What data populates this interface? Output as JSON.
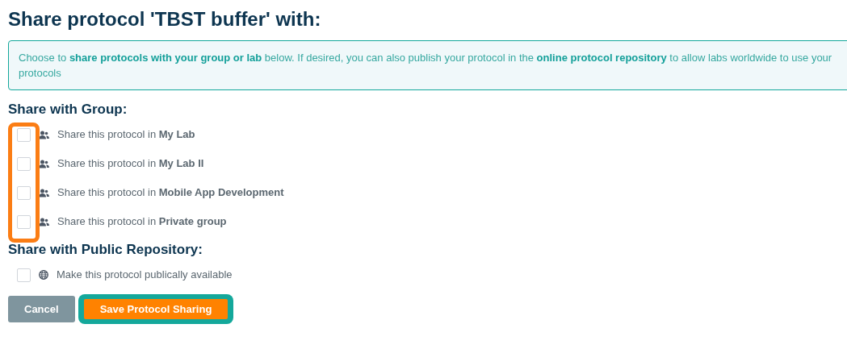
{
  "title": "Share protocol 'TBST buffer' with:",
  "info": "Choose to **share protocols with your group or lab** below. If desired, you can also publish your protocol in the **online protocol repository** to allow labs worldwide to use your protocols",
  "group_section": {
    "heading": "Share with Group:",
    "highlighted": true,
    "options": [
      {
        "text": "Share this protocol in **My Lab**",
        "checked": false
      },
      {
        "text": "Share this protocol in **My Lab II**",
        "checked": false
      },
      {
        "text": "Share this protocol in **Mobile App Development**",
        "checked": false
      },
      {
        "text": "Share this protocol in **Private group**",
        "checked": false
      }
    ]
  },
  "public_section": {
    "heading": "Share with Public Repository:",
    "options": [
      {
        "text": "Make this protocol publically available",
        "checked": false
      }
    ]
  },
  "buttons": [
    {
      "label": "Cancel",
      "kind": "secondary",
      "highlighted": false
    },
    {
      "label": "Save Protocol Sharing",
      "kind": "primary",
      "highlighted": true
    }
  ]
}
